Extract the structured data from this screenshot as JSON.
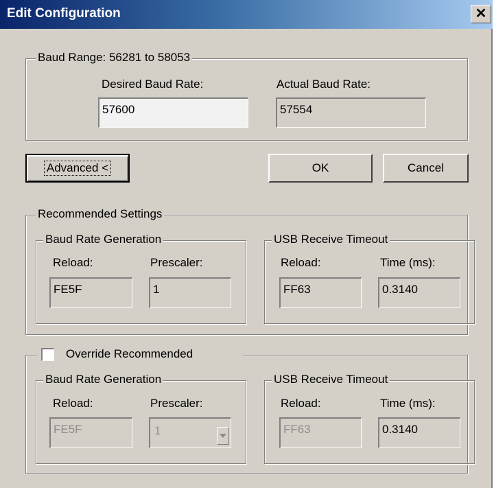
{
  "window": {
    "title": "Edit Configuration",
    "close_glyph": "✕"
  },
  "baud": {
    "range_legend": "Baud Range: 56281 to 58053",
    "desired_label": "Desired Baud Rate:",
    "desired_value": "57600",
    "actual_label": "Actual Baud Rate:",
    "actual_value": "57554"
  },
  "buttons": {
    "advanced": "Advanced <",
    "ok": "OK",
    "cancel": "Cancel"
  },
  "recommended": {
    "legend": "Recommended Settings",
    "brg": {
      "legend": "Baud Rate Generation",
      "reload_label": "Reload:",
      "reload_value": "FE5F",
      "prescaler_label": "Prescaler:",
      "prescaler_value": "1"
    },
    "usb": {
      "legend": "USB Receive Timeout",
      "reload_label": "Reload:",
      "reload_value": "FF63",
      "time_label": "Time (ms):",
      "time_value": "0.3140"
    }
  },
  "override": {
    "checkbox_label": "Override Recommended",
    "checked": false,
    "brg": {
      "legend": "Baud Rate Generation",
      "reload_label": "Reload:",
      "reload_value": "FE5F",
      "prescaler_label": "Prescaler:",
      "prescaler_value": "1"
    },
    "usb": {
      "legend": "USB Receive Timeout",
      "reload_label": "Reload:",
      "reload_value": "FF63",
      "time_label": "Time (ms):",
      "time_value": "0.3140"
    }
  }
}
